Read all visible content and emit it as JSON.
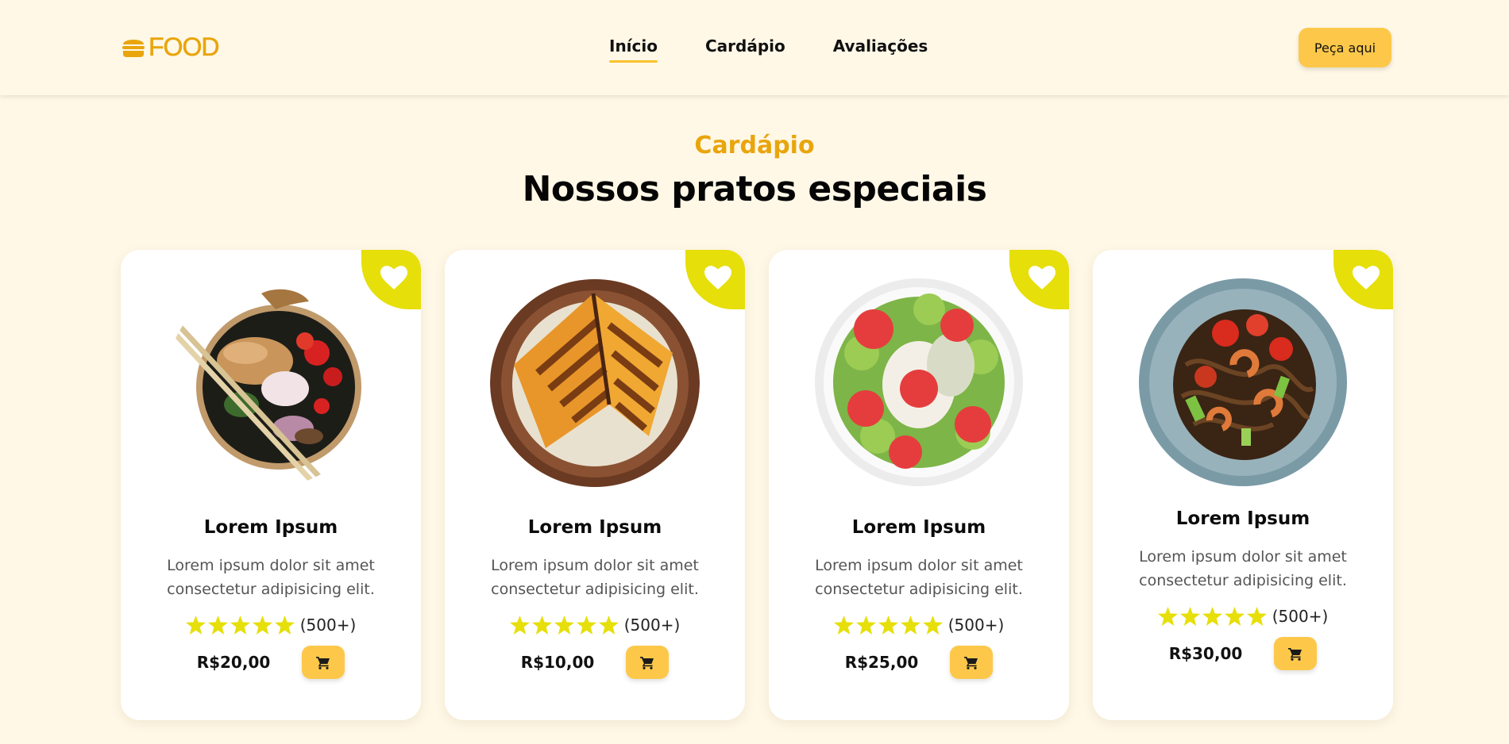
{
  "brand": {
    "logo_text": "FOOD",
    "logo_icon": "burger-icon",
    "accent": "#e9a50d"
  },
  "nav": {
    "items": [
      {
        "label": "Início",
        "active": true
      },
      {
        "label": "Cardápio",
        "active": false
      },
      {
        "label": "Avaliações",
        "active": false
      }
    ],
    "cta_label": "Peça aqui"
  },
  "section": {
    "subtitle": "Cardápio",
    "title": "Nossos pratos especiais"
  },
  "colors": {
    "background": "#fff8e7",
    "button": "#fdc84a",
    "favorite_badge": "#e6df0a",
    "star": "#e6df0a"
  },
  "products": [
    {
      "name": "Lorem Ipsum",
      "description": "Lorem ipsum dolor sit amet consectetur adipisicing elit.",
      "stars": 5,
      "rating_count": "(500+)",
      "price": "R$20,00",
      "image": "poke-bowl-with-chopsticks"
    },
    {
      "name": "Lorem Ipsum",
      "description": "Lorem ipsum dolor sit amet consectetur adipisicing elit.",
      "stars": 5,
      "rating_count": "(500+)",
      "price": "R$10,00",
      "image": "grilled-sandwich-plate"
    },
    {
      "name": "Lorem Ipsum",
      "description": "Lorem ipsum dolor sit amet consectetur adipisicing elit.",
      "stars": 5,
      "rating_count": "(500+)",
      "price": "R$25,00",
      "image": "kiwi-strawberry-smoothie-bowl"
    },
    {
      "name": "Lorem Ipsum",
      "description": "Lorem ipsum dolor sit amet consectetur adipisicing elit.",
      "stars": 5,
      "rating_count": "(500+)",
      "price": "R$30,00",
      "image": "shrimp-noodles-bowl"
    }
  ],
  "icons": {
    "favorite": "heart-icon",
    "cart": "cart-icon",
    "rating": "star-icon"
  }
}
